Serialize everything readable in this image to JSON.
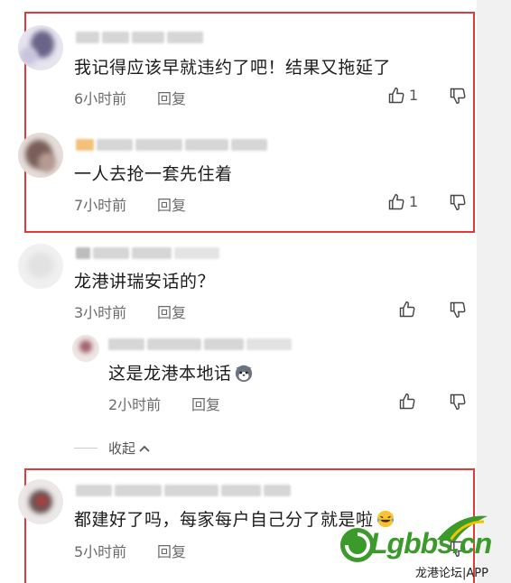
{
  "colors": {
    "highlight": "#e03a3a",
    "brand_green": "#3a9a2a",
    "brand_blue": "#1a63b8"
  },
  "comments": [
    {
      "text": "我记得应该早就违约了吧！结果又拖延了",
      "time": "6小时前",
      "reply": "回复",
      "likes": "1",
      "like_icon": "thumb-up-icon",
      "dislike_icon": "thumb-down-icon"
    },
    {
      "text": "一人去抢一套先住着",
      "time": "7小时前",
      "reply": "回复",
      "likes": "1",
      "like_icon": "thumb-up-icon",
      "dislike_icon": "thumb-down-icon"
    },
    {
      "text": "龙港讲瑞安话的？",
      "time": "3小时前",
      "reply": "回复",
      "likes": "",
      "like_icon": "thumb-up-icon",
      "dislike_icon": "thumb-down-icon"
    },
    {
      "text": "这是龙港本地话",
      "emoji": "husky-face-emoji",
      "time": "2小时前",
      "reply": "回复",
      "likes": "",
      "like_icon": "thumb-up-icon",
      "dislike_icon": "thumb-down-icon"
    },
    {
      "text": "都建好了吗，每家每户自己分了就是啦",
      "emoji": "laughing-emoji",
      "time": "5小时前",
      "reply": "回复",
      "likes": "",
      "like_icon": "thumb-up-icon",
      "dislike_icon": "thumb-down-icon"
    }
  ],
  "collapse": {
    "label": "收起",
    "icon": "chevron-up-icon"
  },
  "watermark": {
    "logo": "Lgbbs.cn",
    "caption": "龙港论坛|APP"
  }
}
